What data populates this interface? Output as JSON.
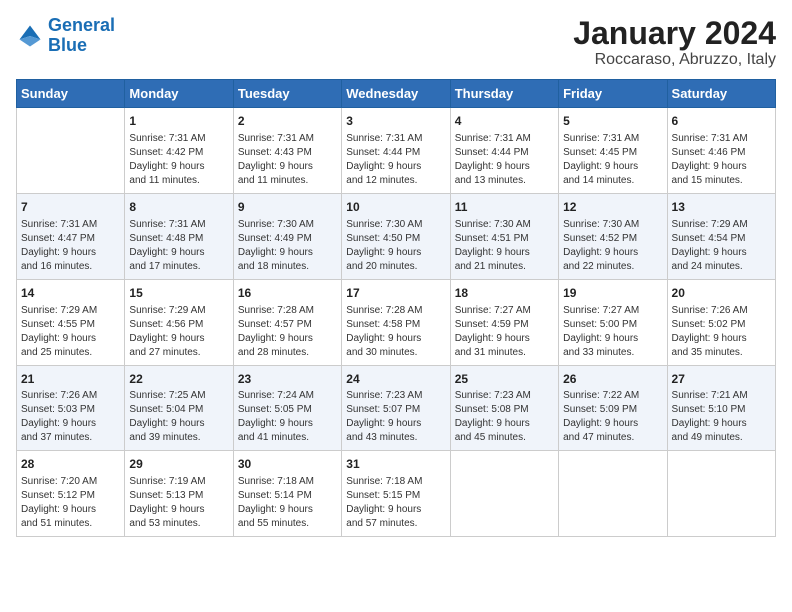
{
  "header": {
    "logo_line1": "General",
    "logo_line2": "Blue",
    "title": "January 2024",
    "subtitle": "Roccaraso, Abruzzo, Italy"
  },
  "weekdays": [
    "Sunday",
    "Monday",
    "Tuesday",
    "Wednesday",
    "Thursday",
    "Friday",
    "Saturday"
  ],
  "weeks": [
    [
      {
        "day": "",
        "info": ""
      },
      {
        "day": "1",
        "info": "Sunrise: 7:31 AM\nSunset: 4:42 PM\nDaylight: 9 hours\nand 11 minutes."
      },
      {
        "day": "2",
        "info": "Sunrise: 7:31 AM\nSunset: 4:43 PM\nDaylight: 9 hours\nand 11 minutes."
      },
      {
        "day": "3",
        "info": "Sunrise: 7:31 AM\nSunset: 4:44 PM\nDaylight: 9 hours\nand 12 minutes."
      },
      {
        "day": "4",
        "info": "Sunrise: 7:31 AM\nSunset: 4:44 PM\nDaylight: 9 hours\nand 13 minutes."
      },
      {
        "day": "5",
        "info": "Sunrise: 7:31 AM\nSunset: 4:45 PM\nDaylight: 9 hours\nand 14 minutes."
      },
      {
        "day": "6",
        "info": "Sunrise: 7:31 AM\nSunset: 4:46 PM\nDaylight: 9 hours\nand 15 minutes."
      }
    ],
    [
      {
        "day": "7",
        "info": "Sunrise: 7:31 AM\nSunset: 4:47 PM\nDaylight: 9 hours\nand 16 minutes."
      },
      {
        "day": "8",
        "info": "Sunrise: 7:31 AM\nSunset: 4:48 PM\nDaylight: 9 hours\nand 17 minutes."
      },
      {
        "day": "9",
        "info": "Sunrise: 7:30 AM\nSunset: 4:49 PM\nDaylight: 9 hours\nand 18 minutes."
      },
      {
        "day": "10",
        "info": "Sunrise: 7:30 AM\nSunset: 4:50 PM\nDaylight: 9 hours\nand 20 minutes."
      },
      {
        "day": "11",
        "info": "Sunrise: 7:30 AM\nSunset: 4:51 PM\nDaylight: 9 hours\nand 21 minutes."
      },
      {
        "day": "12",
        "info": "Sunrise: 7:30 AM\nSunset: 4:52 PM\nDaylight: 9 hours\nand 22 minutes."
      },
      {
        "day": "13",
        "info": "Sunrise: 7:29 AM\nSunset: 4:54 PM\nDaylight: 9 hours\nand 24 minutes."
      }
    ],
    [
      {
        "day": "14",
        "info": "Sunrise: 7:29 AM\nSunset: 4:55 PM\nDaylight: 9 hours\nand 25 minutes."
      },
      {
        "day": "15",
        "info": "Sunrise: 7:29 AM\nSunset: 4:56 PM\nDaylight: 9 hours\nand 27 minutes."
      },
      {
        "day": "16",
        "info": "Sunrise: 7:28 AM\nSunset: 4:57 PM\nDaylight: 9 hours\nand 28 minutes."
      },
      {
        "day": "17",
        "info": "Sunrise: 7:28 AM\nSunset: 4:58 PM\nDaylight: 9 hours\nand 30 minutes."
      },
      {
        "day": "18",
        "info": "Sunrise: 7:27 AM\nSunset: 4:59 PM\nDaylight: 9 hours\nand 31 minutes."
      },
      {
        "day": "19",
        "info": "Sunrise: 7:27 AM\nSunset: 5:00 PM\nDaylight: 9 hours\nand 33 minutes."
      },
      {
        "day": "20",
        "info": "Sunrise: 7:26 AM\nSunset: 5:02 PM\nDaylight: 9 hours\nand 35 minutes."
      }
    ],
    [
      {
        "day": "21",
        "info": "Sunrise: 7:26 AM\nSunset: 5:03 PM\nDaylight: 9 hours\nand 37 minutes."
      },
      {
        "day": "22",
        "info": "Sunrise: 7:25 AM\nSunset: 5:04 PM\nDaylight: 9 hours\nand 39 minutes."
      },
      {
        "day": "23",
        "info": "Sunrise: 7:24 AM\nSunset: 5:05 PM\nDaylight: 9 hours\nand 41 minutes."
      },
      {
        "day": "24",
        "info": "Sunrise: 7:23 AM\nSunset: 5:07 PM\nDaylight: 9 hours\nand 43 minutes."
      },
      {
        "day": "25",
        "info": "Sunrise: 7:23 AM\nSunset: 5:08 PM\nDaylight: 9 hours\nand 45 minutes."
      },
      {
        "day": "26",
        "info": "Sunrise: 7:22 AM\nSunset: 5:09 PM\nDaylight: 9 hours\nand 47 minutes."
      },
      {
        "day": "27",
        "info": "Sunrise: 7:21 AM\nSunset: 5:10 PM\nDaylight: 9 hours\nand 49 minutes."
      }
    ],
    [
      {
        "day": "28",
        "info": "Sunrise: 7:20 AM\nSunset: 5:12 PM\nDaylight: 9 hours\nand 51 minutes."
      },
      {
        "day": "29",
        "info": "Sunrise: 7:19 AM\nSunset: 5:13 PM\nDaylight: 9 hours\nand 53 minutes."
      },
      {
        "day": "30",
        "info": "Sunrise: 7:18 AM\nSunset: 5:14 PM\nDaylight: 9 hours\nand 55 minutes."
      },
      {
        "day": "31",
        "info": "Sunrise: 7:18 AM\nSunset: 5:15 PM\nDaylight: 9 hours\nand 57 minutes."
      },
      {
        "day": "",
        "info": ""
      },
      {
        "day": "",
        "info": ""
      },
      {
        "day": "",
        "info": ""
      }
    ]
  ]
}
